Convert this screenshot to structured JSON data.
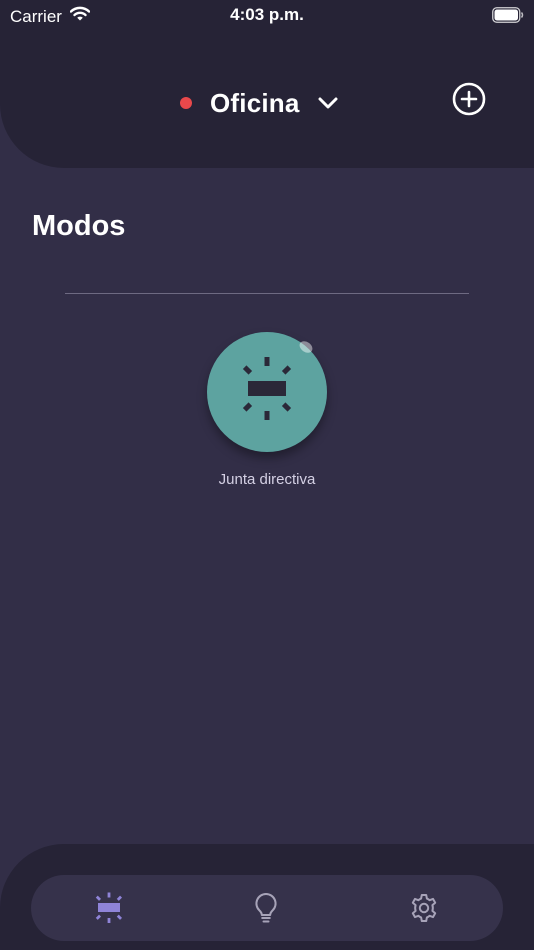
{
  "status_bar": {
    "carrier": "Carrier",
    "time": "4:03 p.m."
  },
  "header": {
    "location_name": "Oficina",
    "location_status_color": "#e8484b",
    "dropdown_icon": "chevron-down-icon",
    "add_icon": "plus-circle-icon"
  },
  "section": {
    "title": "Modos"
  },
  "modes": [
    {
      "label": "Junta directiva",
      "color": "#5da3a0",
      "icon": "scene-icon"
    }
  ],
  "tabbar": {
    "items": [
      {
        "icon": "modes-icon",
        "active": true,
        "color": "#8f84d8"
      },
      {
        "icon": "lightbulb-icon",
        "active": false,
        "color": "#a7a3b8"
      },
      {
        "icon": "gear-icon",
        "active": false,
        "color": "#a7a3b8"
      }
    ]
  },
  "colors": {
    "background": "#322e47",
    "header": "#262336",
    "accent": "#8f84d8"
  }
}
